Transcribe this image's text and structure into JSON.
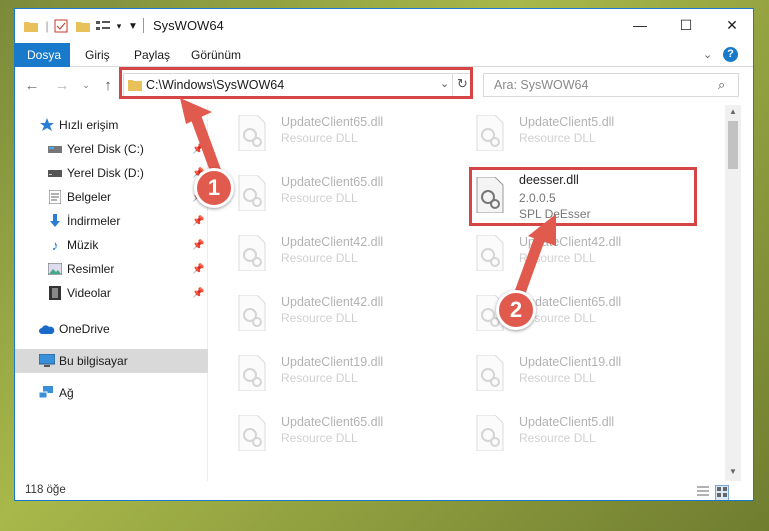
{
  "window": {
    "title": "SysWOW64",
    "controls": {
      "minimize": "—",
      "maximize": "☐",
      "close": "✕"
    }
  },
  "ribbon": {
    "tabs": [
      "Dosya",
      "Giriş",
      "Paylaş",
      "Görünüm"
    ],
    "help": "?"
  },
  "address": {
    "path": "C:\\Windows\\SysWOW64",
    "search_placeholder": "Ara: SysWOW64"
  },
  "sidebar": {
    "items": [
      {
        "label": "Hızlı erişim",
        "icon": "star-icon"
      },
      {
        "label": "Yerel Disk (C:)",
        "icon": "drive-icon",
        "pinned": true
      },
      {
        "label": "Yerel Disk (D:)",
        "icon": "drive-icon",
        "pinned": true
      },
      {
        "label": "Belgeler",
        "icon": "documents-icon",
        "pinned": true
      },
      {
        "label": "İndirmeler",
        "icon": "download-icon",
        "pinned": true
      },
      {
        "label": "Müzik",
        "icon": "music-icon",
        "pinned": true
      },
      {
        "label": "Resimler",
        "icon": "pictures-icon",
        "pinned": true
      },
      {
        "label": "Videolar",
        "icon": "video-icon",
        "pinned": true
      },
      {
        "label": "OneDrive",
        "icon": "cloud-icon"
      },
      {
        "label": "Bu bilgisayar",
        "icon": "computer-icon",
        "selected": true
      },
      {
        "label": "Ağ",
        "icon": "network-icon"
      }
    ]
  },
  "files": [
    {
      "name": "UpdateClient65.dll",
      "desc": "Resource DLL"
    },
    {
      "name": "UpdateClient5.dll",
      "desc": "Resource DLL"
    },
    {
      "name": "UpdateClient65.dll",
      "desc": "Resource DLL"
    },
    {
      "name": "deesser.dll",
      "desc": "2.0.0.5",
      "desc2": "SPL DeEsser",
      "highlighted": true
    },
    {
      "name": "UpdateClient42.dll",
      "desc": "Resource DLL"
    },
    {
      "name": "UpdateClient42.dll",
      "desc": "Resource DLL"
    },
    {
      "name": "UpdateClient42.dll",
      "desc": "Resource DLL"
    },
    {
      "name": "UpdateClient65.dll",
      "desc": "Resource DLL"
    },
    {
      "name": "UpdateClient19.dll",
      "desc": "Resource DLL"
    },
    {
      "name": "UpdateClient19.dll",
      "desc": "Resource DLL"
    },
    {
      "name": "UpdateClient65.dll",
      "desc": "Resource DLL"
    },
    {
      "name": "UpdateClient5.dll",
      "desc": "Resource DLL"
    }
  ],
  "status": {
    "count": "118 öğe"
  },
  "annotations": {
    "step1": "1",
    "step2": "2",
    "color": "#d64545"
  }
}
